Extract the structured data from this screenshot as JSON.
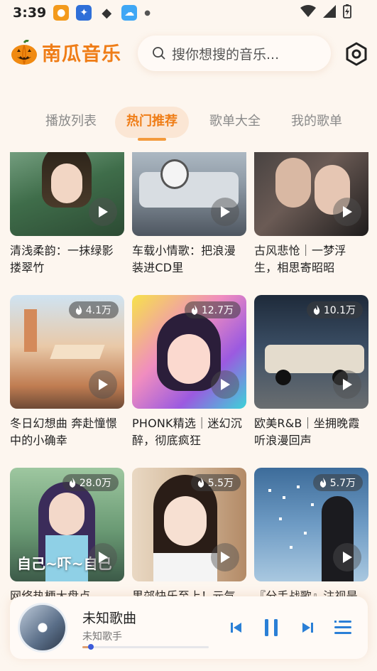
{
  "status": {
    "time": "3:39"
  },
  "app": {
    "name": "南瓜音乐"
  },
  "search": {
    "placeholder": "搜你想搜的音乐..."
  },
  "tabs": [
    {
      "label": "播放列表"
    },
    {
      "label": "热门推荐",
      "active": true
    },
    {
      "label": "歌单大全"
    },
    {
      "label": "我的歌单"
    }
  ],
  "playlists": [
    {
      "title": "清浅柔韵：一抹绿影搂翠竹",
      "plays": ""
    },
    {
      "title": "车载小情歌：把浪漫装进CD里",
      "plays": ""
    },
    {
      "title": "古风悲怆｜一梦浮生，相思寄昭昭",
      "plays": ""
    },
    {
      "title": "冬日幻想曲 奔赴憧憬中的小确幸",
      "plays": "4.1万"
    },
    {
      "title": "PHONK精选｜迷幻沉醉，彻底疯狂",
      "plays": "12.7万"
    },
    {
      "title": "欧美R&B｜坐拥晚霞听浪漫回声",
      "plays": "10.1万"
    },
    {
      "title": "网络热梗大盘点",
      "plays": "28.0万",
      "cover_text": "自己~吓~自己"
    },
    {
      "title": "果郊快乐至上！元气",
      "plays": "5.5万"
    },
    {
      "title": "『分手战歌』注视是",
      "plays": "5.7万"
    }
  ],
  "player": {
    "song": "未知歌曲",
    "artist": "未知歌手",
    "progress": 0.07
  },
  "colors": {
    "accent": "#ef7d17",
    "background": "#fdf6ef"
  }
}
